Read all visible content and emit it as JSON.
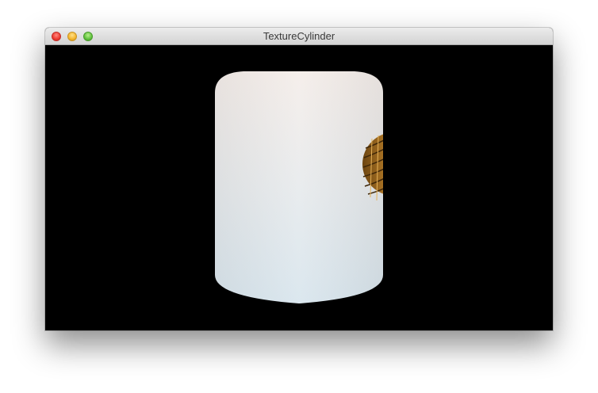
{
  "window": {
    "title": "TextureCylinder"
  },
  "titlebar": {
    "close_icon": "close-icon",
    "minimize_icon": "minimize-icon",
    "zoom_icon": "zoom-icon"
  },
  "scene": {
    "background_color": "#000000",
    "object": "textured-cylinder",
    "texture_colors": {
      "sky_top": "#f4eeea",
      "sky_bottom": "#dae7ef",
      "dome": "#a86d1d"
    }
  }
}
